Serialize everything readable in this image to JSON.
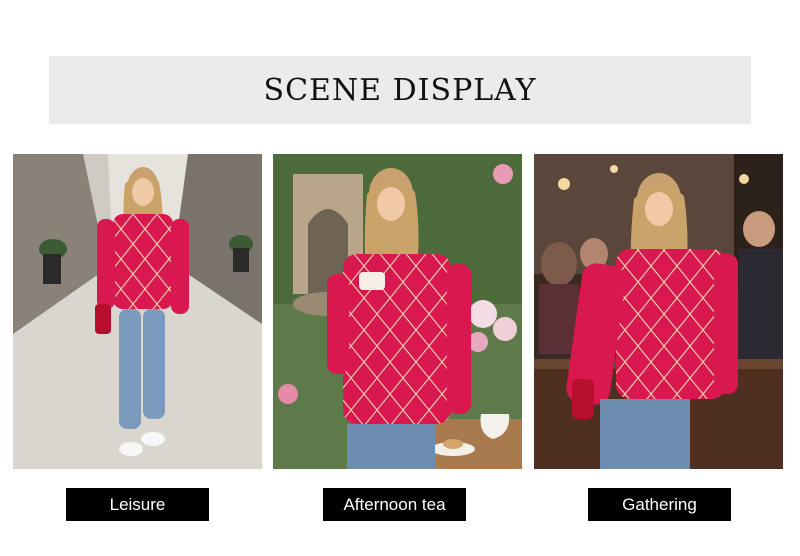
{
  "header": {
    "title": "SCENE DISPLAY"
  },
  "scenes": [
    {
      "caption": "Leisure",
      "image": "street-scene-photo"
    },
    {
      "caption": "Afternoon tea",
      "image": "garden-tea-photo"
    },
    {
      "caption": "Gathering",
      "image": "bar-party-photo"
    }
  ],
  "colors": {
    "title_band": "#ebebeb",
    "caption_bg": "#000000",
    "caption_text": "#ffffff",
    "sweater": "#d8184f",
    "argyle_line": "#f3c7a8"
  }
}
